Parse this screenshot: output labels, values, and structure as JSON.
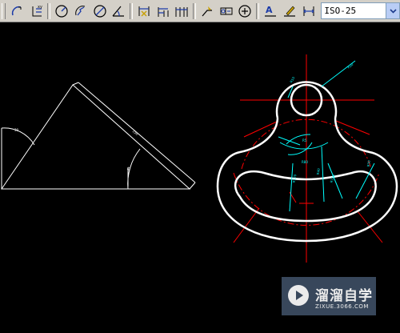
{
  "toolbar": {
    "dim_style_value": "ISO-25",
    "buttons": [
      "dim-arc-length-icon",
      "dim-ordinate-icon",
      "dim-radius-icon",
      "dim-jogged-icon",
      "dim-diameter-icon",
      "dim-angular-icon",
      "quick-dim-icon",
      "dim-baseline-icon",
      "dim-continue-icon",
      "quick-leader-icon",
      "tolerance-icon",
      "center-mark-icon",
      "dim-edit-icon",
      "dim-text-edit-icon",
      "dim-update-icon"
    ]
  },
  "watermark": {
    "title": "溜溜自学",
    "url": "ZIXUE.3066.COM"
  },
  "colors": {
    "toolbar_bg": "#d4d0c8",
    "canvas_bg": "#000000",
    "object_line": "#ffffff",
    "center_line": "#ff0000",
    "dimension": "#00ffff",
    "watermark_bg": "#3d4e63"
  }
}
